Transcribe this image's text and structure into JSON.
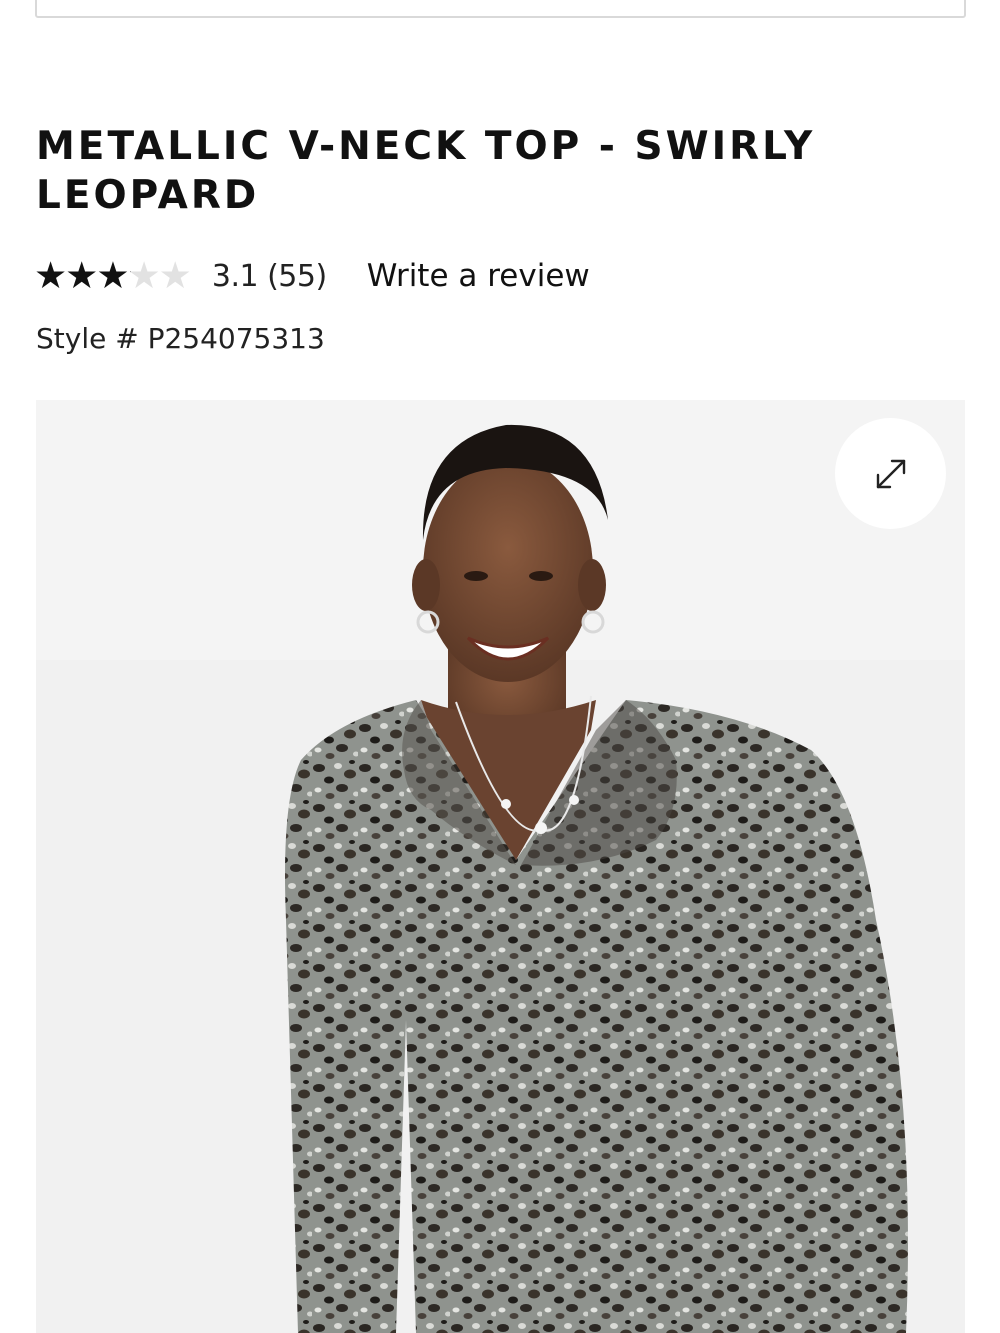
{
  "product": {
    "title": "METALLIC V-NECK TOP - SWIRLY LEOPARD",
    "rating": {
      "score": 3.1,
      "max": 5,
      "stars_glyphs": "★★★★★",
      "text": "3.1 (55)",
      "star_color": "#111111",
      "empty_star_color": "#e2e2e2"
    },
    "write_review_label": "Write a review",
    "style_number": "Style # P254075313"
  },
  "gallery": {
    "expand_icon": "expand-arrows-icon",
    "image_subject": "model wearing leopard print ruffled v-neck top"
  }
}
